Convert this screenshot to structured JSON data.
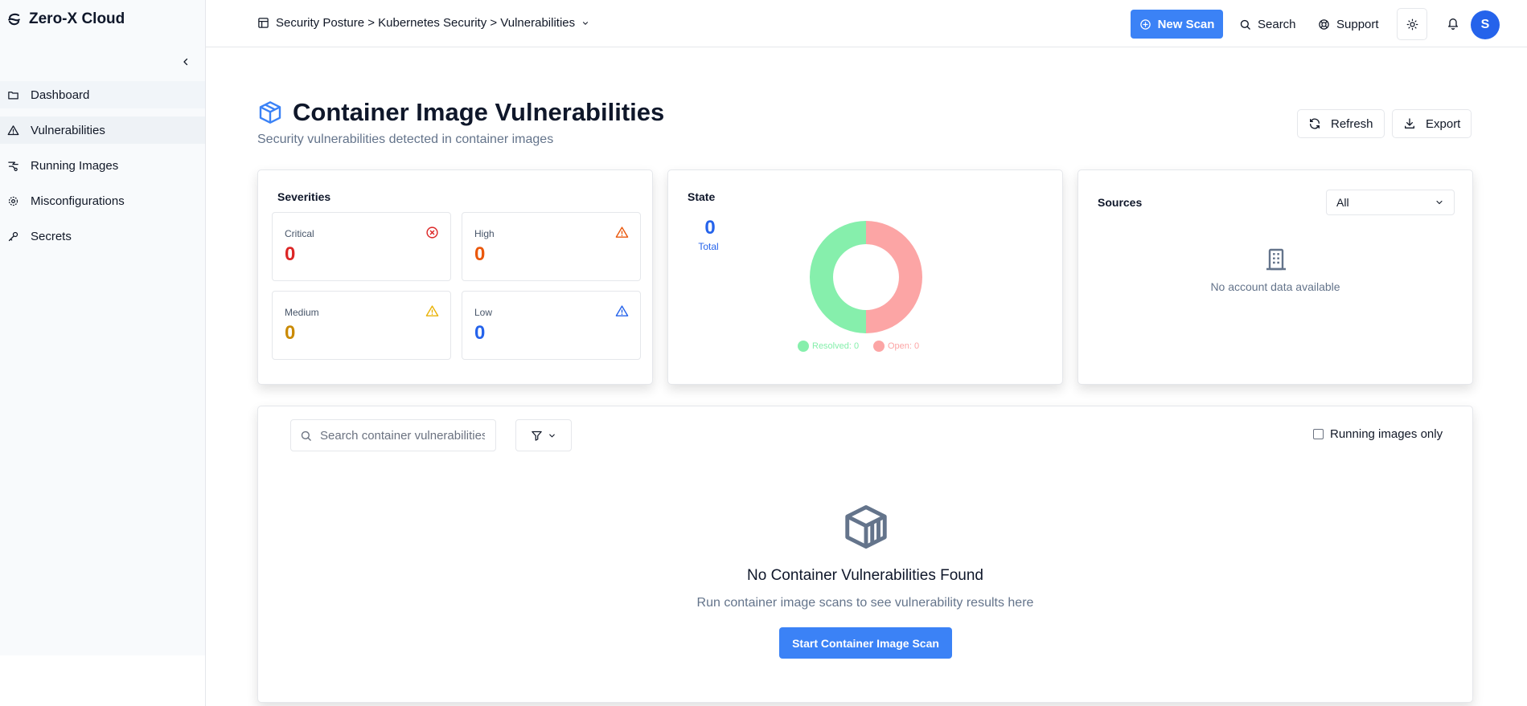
{
  "app": {
    "name": "Zero-X Cloud"
  },
  "sidebar": {
    "items": [
      {
        "label": "Dashboard",
        "icon": "folder-icon"
      },
      {
        "label": "Vulnerabilities",
        "icon": "alert-triangle-icon"
      },
      {
        "label": "Running Images",
        "icon": "layers-icon"
      },
      {
        "label": "Misconfigurations",
        "icon": "gear-icon"
      },
      {
        "label": "Secrets",
        "icon": "key-icon"
      }
    ]
  },
  "header": {
    "breadcrumb": "Security Posture > Kubernetes Security > Vulnerabilities",
    "new_scan_label": "New Scan",
    "search_label": "Search",
    "support_label": "Support",
    "avatar_initial": "S"
  },
  "page": {
    "title": "Container Image Vulnerabilities",
    "subtitle": "Security vulnerabilities detected in container images",
    "refresh_label": "Refresh",
    "export_label": "Export"
  },
  "severities": {
    "title": "Severities",
    "items": [
      {
        "label": "Critical",
        "value": "0",
        "color": "#dc2626"
      },
      {
        "label": "High",
        "value": "0",
        "color": "#ea580c"
      },
      {
        "label": "Medium",
        "value": "0",
        "color": "#ca8a04"
      },
      {
        "label": "Low",
        "value": "0",
        "color": "#2563eb"
      }
    ]
  },
  "state": {
    "title": "State",
    "total_value": "0",
    "total_label": "Total",
    "resolved_legend": "Resolved: 0",
    "open_legend": "Open: 0",
    "resolved_color": "#86efac",
    "open_color": "#fca5a5"
  },
  "sources": {
    "title": "Sources",
    "selected_option": "All",
    "empty_text": "No account data available"
  },
  "table": {
    "search_placeholder": "Search container vulnerabilities",
    "running_only_label": "Running images only",
    "running_only_checked": false,
    "empty_title": "No Container Vulnerabilities Found",
    "empty_subtitle": "Run container image scans to see vulnerability results here",
    "start_scan_label": "Start Container Image Scan"
  },
  "colors": {
    "accent": "#3b82f6",
    "brand": "#2563eb"
  }
}
